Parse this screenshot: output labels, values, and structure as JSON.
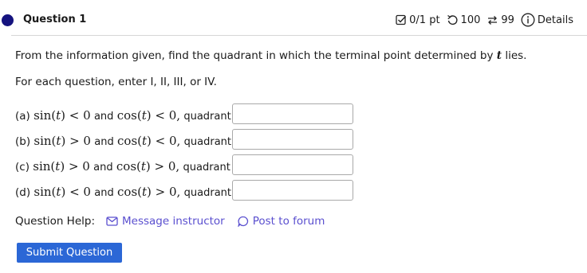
{
  "question": {
    "title": "Question 1",
    "score": "0/1 pt",
    "tries": "100",
    "attempts": "99",
    "details_label": "Details",
    "icons": [
      "checkbox-icon",
      "retry-icon",
      "attempts-icon",
      "info-icon"
    ]
  },
  "prompt_before": "From the information given, find the quadrant in which the terminal point determined by ",
  "prompt_var": "t",
  "prompt_after": " lies.",
  "instruction": "For each question, enter I, II, III, or IV.",
  "parts": [
    {
      "letter": "(a)",
      "sin_rel": "<",
      "cos_rel": "<",
      "suffix": "quadrant",
      "value": ""
    },
    {
      "letter": "(b)",
      "sin_rel": ">",
      "cos_rel": "<",
      "suffix": "quadrant",
      "value": ""
    },
    {
      "letter": "(c)",
      "sin_rel": ">",
      "cos_rel": ">",
      "suffix": "quadrant",
      "value": ""
    },
    {
      "letter": "(d)",
      "sin_rel": "<",
      "cos_rel": ">",
      "suffix": "quadrant",
      "value": ""
    }
  ],
  "help": {
    "label": "Question Help:",
    "message": "Message instructor",
    "forum": "Post to forum"
  },
  "submit_label": "Submit Question",
  "colors": {
    "accent": "#2b67d6",
    "link": "#5a4fcf",
    "dot": "#15137f"
  }
}
